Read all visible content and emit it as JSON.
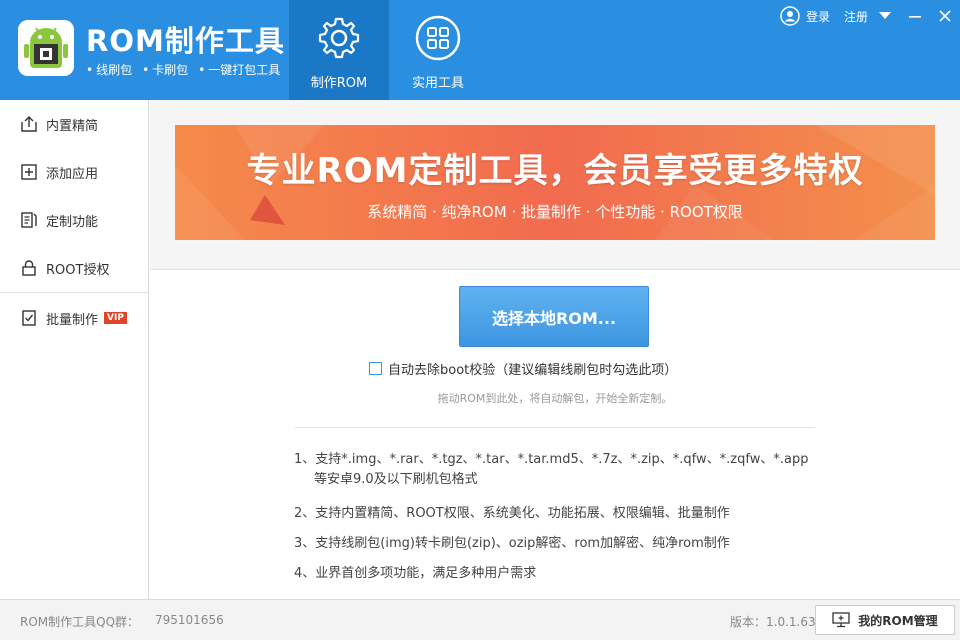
{
  "header": {
    "title": "ROM制作工具",
    "subtitle_items": [
      "线刷包",
      "卡刷包",
      "一键打包工具"
    ],
    "tabs": [
      {
        "label": "制作ROM",
        "icon": "gear-icon",
        "active": true
      },
      {
        "label": "实用工具",
        "icon": "grid-icon",
        "active": false
      }
    ],
    "login": "登录",
    "register": "注册"
  },
  "sidebar": {
    "items": [
      {
        "label": "内置精简",
        "icon": "upload-icon"
      },
      {
        "label": "添加应用",
        "icon": "plus-box-icon"
      },
      {
        "label": "定制功能",
        "icon": "edit-list-icon"
      },
      {
        "label": "ROOT授权",
        "icon": "lock-icon"
      },
      {
        "label": "批量制作",
        "icon": "checklist-icon",
        "badge": "VIP"
      }
    ]
  },
  "banner": {
    "title": "专业ROM定制工具，会员享受更多特权",
    "subtitle": "系统精简 · 纯净ROM · 批量制作 · 个性功能 · ROOT权限"
  },
  "main": {
    "select_button": "选择本地ROM...",
    "checkbox_label": "自动去除boot校验（建议编辑线刷包时勾选此项）",
    "checkbox_checked": false,
    "drag_hint": "拖动ROM到此处，将自动解包，开始全新定制。",
    "features": [
      {
        "num": "1、",
        "line1": "支持*.img、*.rar、*.tgz、*.tar、*.tar.md5、*.7z、*.zip、*.qfw、*.zqfw、*.app",
        "line2": "等安卓9.0及以下刷机包格式"
      },
      {
        "num": "2、",
        "line1": "支持内置精简、ROOT权限、系统美化、功能拓展、权限编辑、批量制作",
        "line2": ""
      },
      {
        "num": "3、",
        "line1": "支持线刷包(img)转卡刷包(zip)、ozip解密、rom加解密、纯净rom制作",
        "line2": ""
      },
      {
        "num": "4、",
        "line1": "业界首创多项功能，满足多种用户需求",
        "line2": ""
      }
    ]
  },
  "footer": {
    "qq_label": "ROM制作工具QQ群：",
    "qq_number": "795101656",
    "version": "版本：1.0.1.63",
    "manage_button": "我的ROM管理"
  },
  "colors": {
    "header_bg": "#2a8fe0",
    "active_tab_bg": "#1b78c7",
    "banner_orange": "#f26b4f",
    "primary_button": "#3d96e0",
    "vip_badge": "#e0442a"
  }
}
